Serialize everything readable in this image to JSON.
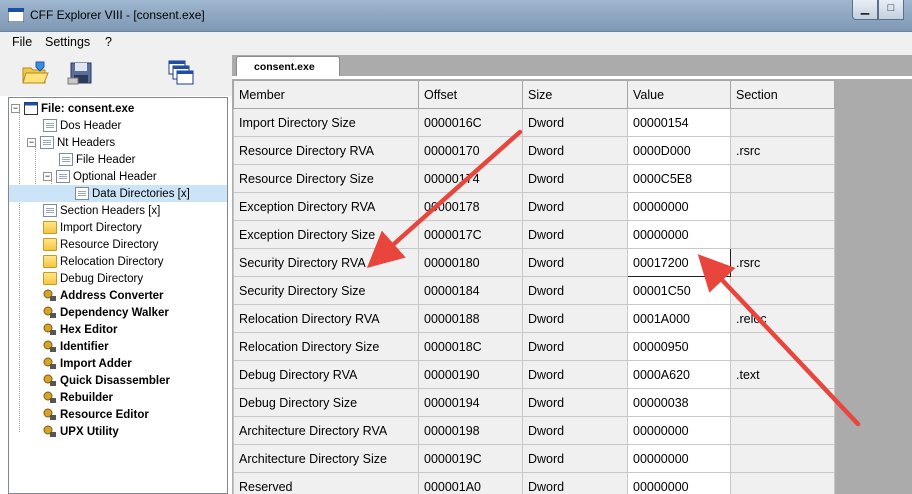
{
  "window": {
    "title": "CFF Explorer VIII - [consent.exe]",
    "controls": [
      "minimize",
      "maximize",
      "close"
    ]
  },
  "menu": [
    "File",
    "Settings",
    "?"
  ],
  "toolbar": {
    "icons": [
      "open-folder-icon",
      "save-disk-icon",
      "windows-icon"
    ]
  },
  "tree": {
    "root": "File: consent.exe",
    "items": [
      "Dos Header",
      "Nt Headers",
      "File Header",
      "Optional Header",
      "Data Directories [x]",
      "Section Headers [x]",
      "Import Directory",
      "Resource Directory",
      "Relocation Directory",
      "Debug Directory",
      "Address Converter",
      "Dependency Walker",
      "Hex Editor",
      "Identifier",
      "Import Adder",
      "Quick Disassembler",
      "Rebuilder",
      "Resource Editor",
      "UPX Utility"
    ],
    "selected": "Data Directories [x]"
  },
  "tab": {
    "label": "consent.exe"
  },
  "table": {
    "columns": [
      "Member",
      "Offset",
      "Size",
      "Value",
      "Section"
    ],
    "rows": [
      [
        "Import Directory Size",
        "0000016C",
        "Dword",
        "00000154",
        ""
      ],
      [
        "Resource Directory RVA",
        "00000170",
        "Dword",
        "0000D000",
        ".rsrc"
      ],
      [
        "Resource Directory Size",
        "00000174",
        "Dword",
        "0000C5E8",
        ""
      ],
      [
        "Exception Directory RVA",
        "00000178",
        "Dword",
        "00000000",
        ""
      ],
      [
        "Exception Directory Size",
        "0000017C",
        "Dword",
        "00000000",
        ""
      ],
      [
        "Security Directory RVA",
        "00000180",
        "Dword",
        "00017200",
        ".rsrc"
      ],
      [
        "Security Directory Size",
        "00000184",
        "Dword",
        "00001C50",
        ""
      ],
      [
        "Relocation Directory RVA",
        "00000188",
        "Dword",
        "0001A000",
        ".reloc"
      ],
      [
        "Relocation Directory Size",
        "0000018C",
        "Dword",
        "00000950",
        ""
      ],
      [
        "Debug Directory RVA",
        "00000190",
        "Dword",
        "0000A620",
        ".text"
      ],
      [
        "Debug Directory Size",
        "00000194",
        "Dword",
        "00000038",
        ""
      ],
      [
        "Architecture Directory RVA",
        "00000198",
        "Dword",
        "00000000",
        ""
      ],
      [
        "Architecture Directory Size",
        "0000019C",
        "Dword",
        "00000000",
        ""
      ],
      [
        "Reserved",
        "000001A0",
        "Dword",
        "00000000",
        ""
      ]
    ],
    "selected_row": 5
  },
  "annotation_color": "#e8453c"
}
